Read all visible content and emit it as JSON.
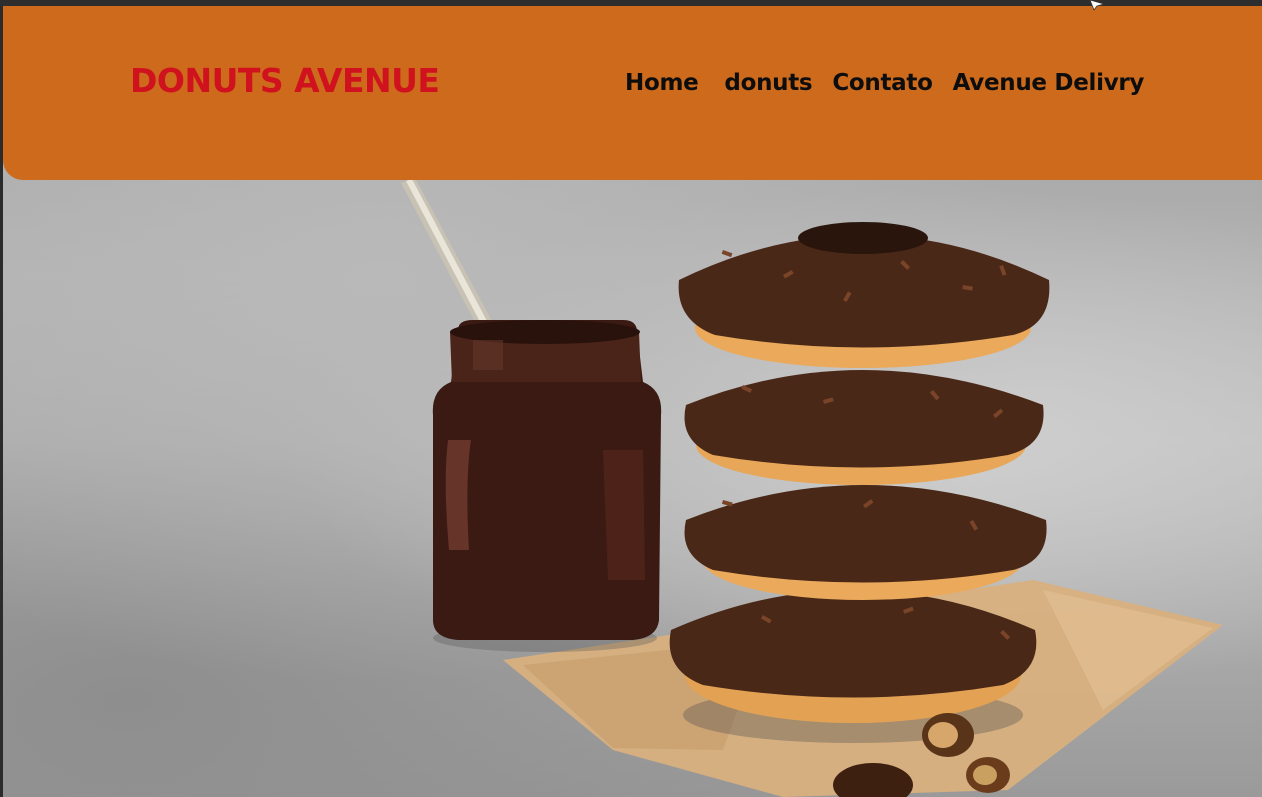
{
  "brand": {
    "name": "DONUTS AVENUE"
  },
  "nav": {
    "items": [
      {
        "label": "Home"
      },
      {
        "label": "donuts"
      },
      {
        "label": "Contato"
      },
      {
        "label": "Avenue Delivry"
      }
    ]
  },
  "hero": {
    "image": "donut-stack-photo"
  },
  "colors": {
    "header_bg": "#cd6a1b",
    "brand_text": "#d0121e",
    "nav_text": "#0d0d0d"
  }
}
